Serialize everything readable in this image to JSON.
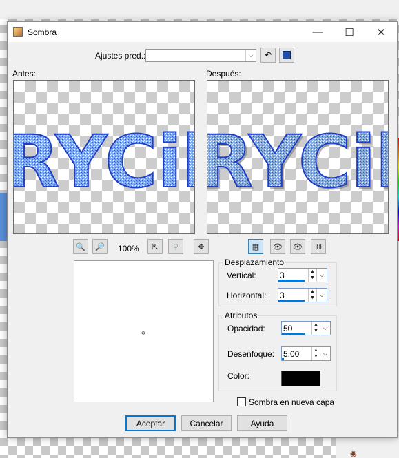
{
  "window": {
    "title": "Sombra",
    "minimize_glyph": "—",
    "maximize_glyph": "☐",
    "close_glyph": "✕"
  },
  "presets": {
    "label": "Ajustes pred.:",
    "value": "",
    "dropdown_glyph": "⌵"
  },
  "previews": {
    "before_label": "Antes:",
    "after_label": "Después:",
    "sample_text": "RYCil"
  },
  "preview_toolbar": {
    "zoom_level": "100%"
  },
  "offset": {
    "group_title": "Desplazamiento",
    "vertical_label": "Vertical:",
    "vertical_value": "3",
    "horizontal_label": "Horizontal:",
    "horizontal_value": "3"
  },
  "attributes": {
    "group_title": "Atributos",
    "opacity_label": "Opacidad:",
    "opacity_value": "50",
    "blur_label": "Desenfoque:",
    "blur_value": "5.00",
    "color_label": "Color:",
    "color_value": "#000000"
  },
  "new_layer": {
    "label": "Sombra en nueva capa",
    "checked": false
  },
  "buttons": {
    "accept": "Aceptar",
    "cancel": "Cancelar",
    "help": "Ayuda"
  },
  "colors": {
    "accent": "#0078d7",
    "text_fill": "#7ea4df",
    "text_stroke": "#1f3fc8"
  }
}
